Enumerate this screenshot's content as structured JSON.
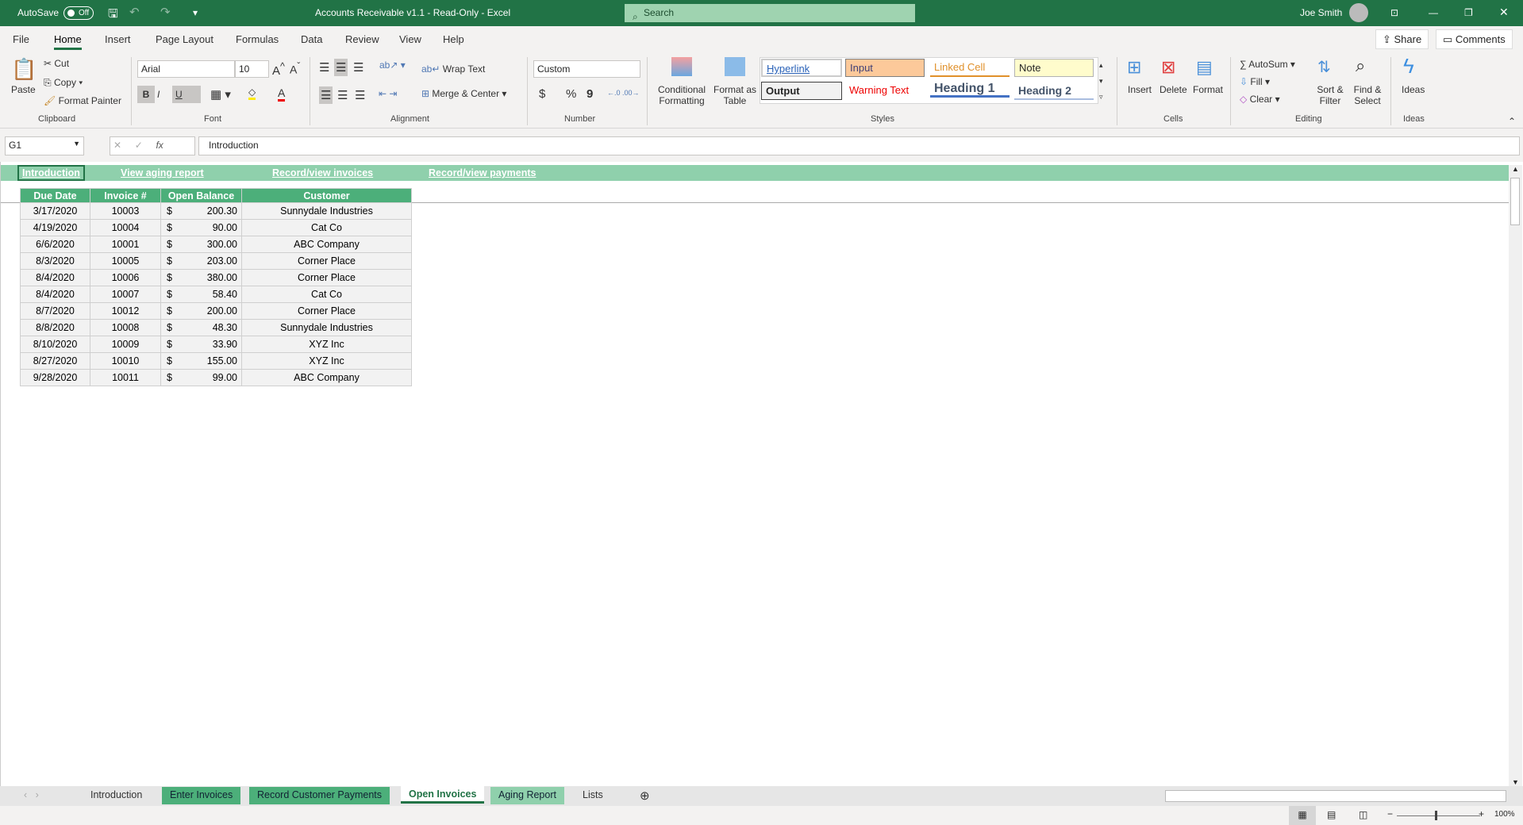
{
  "titlebar": {
    "autosave": "AutoSave",
    "toggle": "Off",
    "title": "Accounts Receivable v1.1  -  Read-Only  -  Excel",
    "search": "Search",
    "user": "Joe Smith"
  },
  "menu": {
    "tabs": [
      "File",
      "Home",
      "Insert",
      "Page Layout",
      "Formulas",
      "Data",
      "Review",
      "View",
      "Help"
    ],
    "share": "Share",
    "comments": "Comments"
  },
  "ribbon": {
    "clipboard": {
      "paste": "Paste",
      "cut": "Cut",
      "copy": "Copy",
      "format_painter": "Format Painter",
      "label": "Clipboard"
    },
    "font": {
      "name": "Arial",
      "size": "10",
      "bold": "B",
      "italic": "I",
      "underline": "U",
      "label": "Font"
    },
    "alignment": {
      "wrap": "Wrap Text",
      "merge": "Merge & Center",
      "label": "Alignment"
    },
    "number": {
      "format": "Custom",
      "dollar": "$",
      "percent": "%",
      "comma": "9",
      "label": "Number"
    },
    "styles": {
      "cond": "Conditional Formatting",
      "fmt_table": "Format as Table",
      "cells": [
        "Hyperlink",
        "Input",
        "Linked Cell",
        "Note",
        "Output",
        "Warning Text",
        "Heading 1",
        "Heading 2"
      ],
      "label": "Styles"
    },
    "cells": {
      "insert": "Insert",
      "delete": "Delete",
      "format": "Format",
      "label": "Cells"
    },
    "editing": {
      "autosum": "AutoSum",
      "fill": "Fill",
      "clear": "Clear",
      "sort": "Sort & Filter",
      "find": "Find & Select",
      "label": "Editing"
    },
    "ideas": {
      "ideas": "Ideas",
      "label": "Ideas"
    }
  },
  "formula_bar": {
    "name_box": "G1",
    "fx": "fx",
    "value": "Introduction"
  },
  "nav_links": [
    "Introduction",
    "View aging report",
    "Record/view invoices",
    "Record/view payments"
  ],
  "table": {
    "headers": [
      "Due Date",
      "Invoice #",
      "Open Balance",
      "Customer"
    ],
    "rows": [
      [
        "3/17/2020",
        "10003",
        "$",
        "200.30",
        "Sunnydale Industries"
      ],
      [
        "4/19/2020",
        "10004",
        "$",
        "90.00",
        "Cat Co"
      ],
      [
        "6/6/2020",
        "10001",
        "$",
        "300.00",
        "ABC Company"
      ],
      [
        "8/3/2020",
        "10005",
        "$",
        "203.00",
        "Corner Place"
      ],
      [
        "8/4/2020",
        "10006",
        "$",
        "380.00",
        "Corner Place"
      ],
      [
        "8/4/2020",
        "10007",
        "$",
        "58.40",
        "Cat Co"
      ],
      [
        "8/7/2020",
        "10012",
        "$",
        "200.00",
        "Corner Place"
      ],
      [
        "8/8/2020",
        "10008",
        "$",
        "48.30",
        "Sunnydale Industries"
      ],
      [
        "8/10/2020",
        "10009",
        "$",
        "33.90",
        "XYZ Inc"
      ],
      [
        "8/27/2020",
        "10010",
        "$",
        "155.00",
        "XYZ Inc"
      ],
      [
        "9/28/2020",
        "10011",
        "$",
        "99.00",
        "ABC Company"
      ]
    ]
  },
  "sheet_tabs": [
    "Introduction",
    "Enter Invoices",
    "Record Customer Payments",
    "Open Invoices",
    "Aging Report",
    "Lists"
  ],
  "status": {
    "zoom": "100%"
  },
  "colors": {
    "excel_green": "#217346",
    "header_green": "#4caf7a",
    "link_row": "#8fd0ac"
  }
}
